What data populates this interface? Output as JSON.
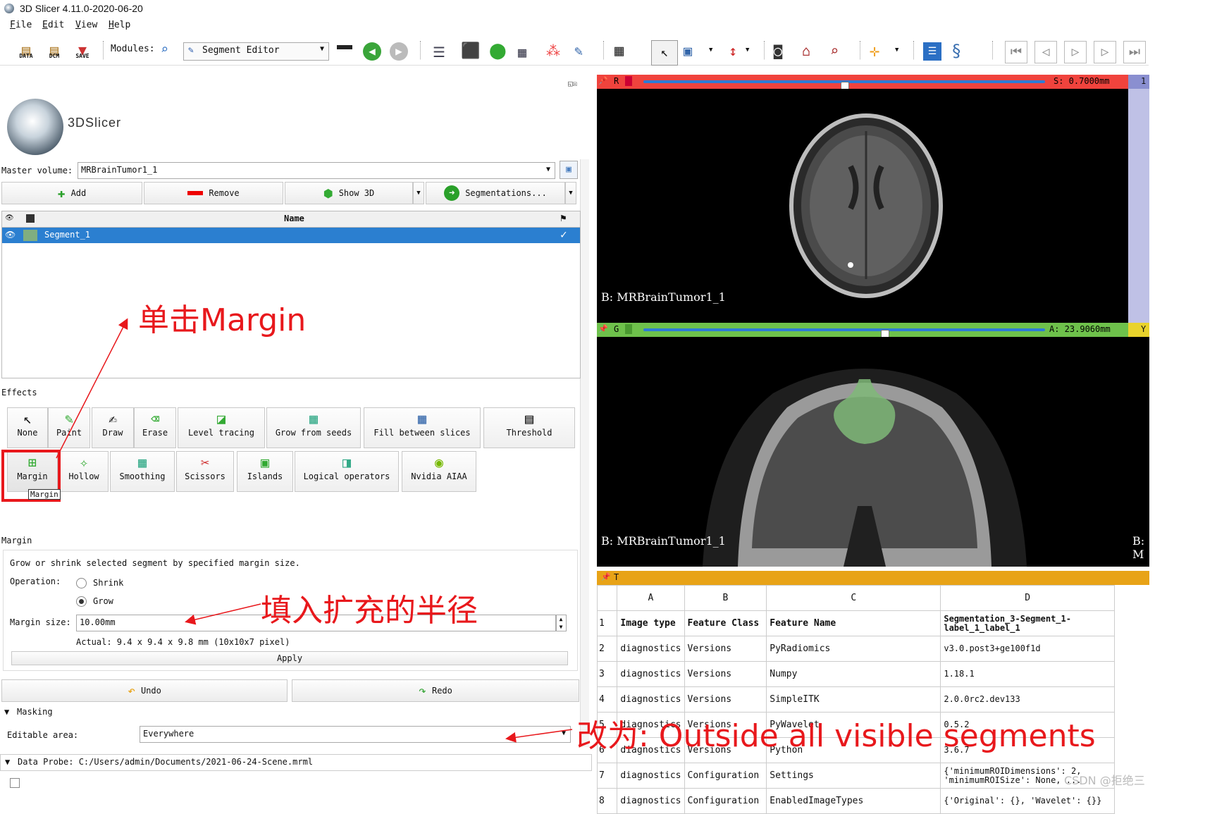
{
  "window": {
    "title": "3D Slicer 4.11.0-2020-06-20"
  },
  "menu": [
    "File",
    "Edit",
    "View",
    "Help"
  ],
  "toolbar": {
    "data_label": "DATA",
    "dcm_label": "DCM",
    "save_label": "SAVE",
    "modules_label": "Modules:",
    "module_selected": "Segment Editor"
  },
  "logo": {
    "text": "3DSlicer"
  },
  "editor": {
    "master_volume_label": "Master volume:",
    "master_volume_value": "MRBrainTumor1_1",
    "add_label": "Add",
    "remove_label": "Remove",
    "show3d_label": "Show 3D",
    "segmentations_label": "Segmentations...",
    "table_header_name": "Name",
    "segment_name": "Segment_1"
  },
  "effects": {
    "title": "Effects",
    "row1": [
      "None",
      "Paint",
      "Draw",
      "Erase",
      "Level tracing",
      "Grow from seeds",
      "Fill between slices",
      "Threshold"
    ],
    "row2": [
      "Margin",
      "Hollow",
      "Smoothing",
      "Scissors",
      "Islands",
      "Logical operators",
      "Nvidia AIAA"
    ],
    "tooltip": "Margin"
  },
  "margin": {
    "section_title": "Margin",
    "description": "Grow or shrink selected segment by specified margin size.",
    "operation_label": "Operation:",
    "shrink_label": "Shrink",
    "grow_label": "Grow",
    "margin_size_label": "Margin size:",
    "margin_size_value": "10.00mm",
    "actual_text": "Actual: 9.4 x 9.4 x 9.8 mm (10x10x7 pixel)",
    "apply_label": "Apply",
    "undo_label": "Undo",
    "redo_label": "Redo",
    "masking_label": "Masking",
    "editable_area_label": "Editable area:",
    "editable_area_value": "Everywhere"
  },
  "data_probe": {
    "text": "Data Probe: C:/Users/admin/Documents/2021-06-24-Scene.mrml"
  },
  "views": {
    "red": {
      "letter": "R",
      "offset": "S: 0.7000mm",
      "label": "B: MRBrainTumor1_1",
      "slider_fraction": 0.5,
      "color": "#f0433d"
    },
    "green": {
      "letter": "G",
      "offset": "A: 23.9060mm",
      "label": "B: MRBrainTumor1_1",
      "slider_fraction": 0.6,
      "color": "#6ec14b"
    },
    "yellow": {
      "letter": "Y",
      "label": "B: M"
    },
    "threeD": {
      "letter": "1"
    },
    "table_view": {
      "letter": "T"
    }
  },
  "feature_table": {
    "columns": [
      "A",
      "B",
      "C",
      "D"
    ],
    "header": [
      "Image type",
      "Feature Class",
      "Feature Name",
      "Segmentation_3-Segment_1-label_1_label_1"
    ],
    "rows": [
      {
        "n": "1",
        "cells": [
          "Image type",
          "Feature Class",
          "Feature Name",
          "Segmentation_3-Segment_1-label_1_label_1"
        ]
      },
      {
        "n": "2",
        "cells": [
          "diagnostics",
          "Versions",
          "PyRadiomics",
          "v3.0.post3+ge100f1d"
        ]
      },
      {
        "n": "3",
        "cells": [
          "diagnostics",
          "Versions",
          "Numpy",
          "1.18.1"
        ]
      },
      {
        "n": "4",
        "cells": [
          "diagnostics",
          "Versions",
          "SimpleITK",
          "2.0.0rc2.dev133"
        ]
      },
      {
        "n": "5",
        "cells": [
          "diagnostics",
          "Versions",
          "PyWavelet",
          "0.5.2"
        ]
      },
      {
        "n": "6",
        "cells": [
          "diagnostics",
          "Versions",
          "Python",
          "3.6.7"
        ]
      },
      {
        "n": "7",
        "cells": [
          "diagnostics",
          "Configuration",
          "Settings",
          "{'minimumROIDimensions': 2, 'minimumROISize': None, ..."
        ]
      },
      {
        "n": "8",
        "cells": [
          "diagnostics",
          "Configuration",
          "EnabledImageTypes",
          "{'Original': {}, 'Wavelet': {}}"
        ]
      }
    ]
  },
  "annotations": {
    "click_margin": "单击Margin",
    "fill_radius": "填入扩充的半径",
    "change_to": "改为: Outside all visible segments",
    "accent": "#e8181c"
  },
  "watermark": "CSDN @拒绝三"
}
